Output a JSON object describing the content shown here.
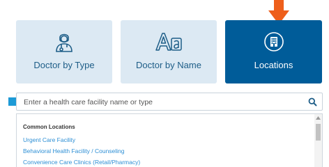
{
  "tiles": [
    {
      "label": "Doctor by Type",
      "icon": "doctor-icon"
    },
    {
      "label": "Doctor by Name",
      "icon": "text-size-icon"
    },
    {
      "label": "Locations",
      "icon": "building-icon",
      "selected": true
    }
  ],
  "search": {
    "placeholder": "Enter a health care facility name or type",
    "icon": "search-icon"
  },
  "dropdown": {
    "heading": "Common Locations",
    "items": [
      "Urgent Care Facility",
      "Behavioral Health Facility / Counseling",
      "Convenience Care Clinics (Retail/Pharmacy)"
    ]
  },
  "colors": {
    "tile_bg": "#dce9f3",
    "tile_selected_bg": "#005c99",
    "tile_text": "#1d5d87",
    "link": "#2d8fd5",
    "arrow_orange": "#ee5f1b",
    "arrow_blue": "#1d9ad6"
  }
}
